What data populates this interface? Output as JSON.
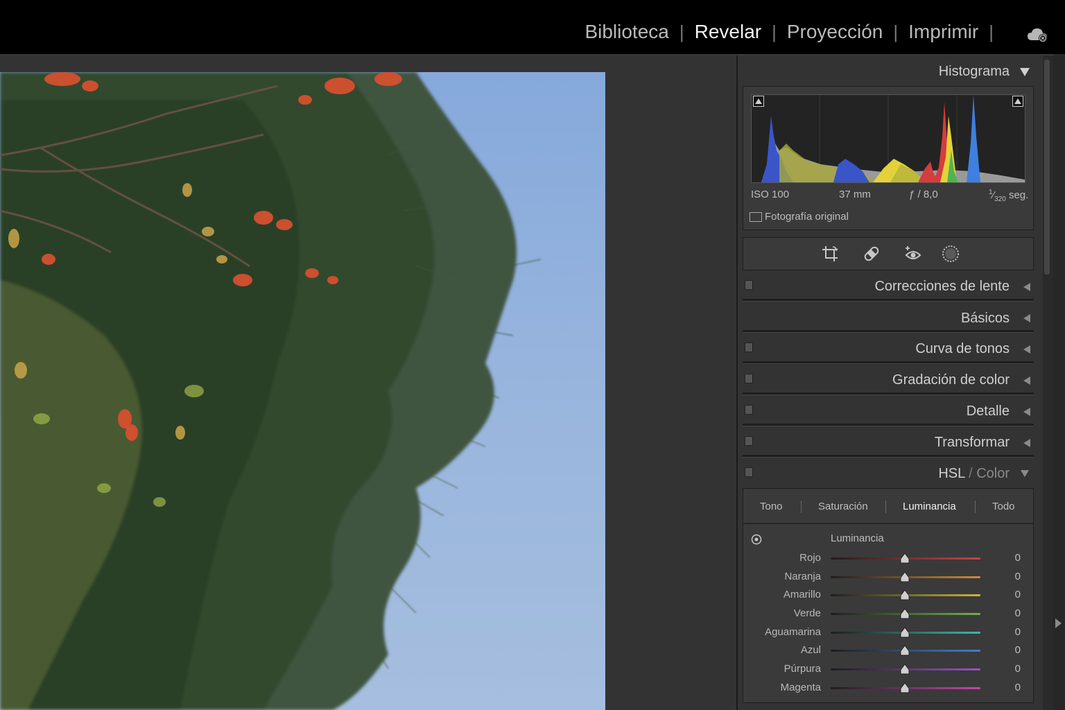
{
  "modules": {
    "items": [
      {
        "label": "Biblioteca",
        "active": false
      },
      {
        "label": "Revelar",
        "active": true
      },
      {
        "label": "Proyección",
        "active": false
      },
      {
        "label": "Imprimir",
        "active": false
      }
    ],
    "cloud_icon": "cloud-sync-icon"
  },
  "histogram": {
    "title": "Histograma",
    "iso": "ISO 100",
    "focal": "37 mm",
    "aperture": "ƒ / 8,0",
    "shutter_num": "1",
    "shutter_den": "320",
    "shutter_unit": "seg.",
    "original_label": "Fotografía original"
  },
  "tools": [
    "crop-icon",
    "healing-icon",
    "redeye-icon",
    "mask-icon"
  ],
  "panels": [
    {
      "title": "Correcciones de lente",
      "has_switch": true
    },
    {
      "title": "Básicos",
      "has_switch": false
    },
    {
      "title": "Curva de tonos",
      "has_switch": true
    },
    {
      "title": "Gradación de color",
      "has_switch": true
    },
    {
      "title": "Detalle",
      "has_switch": true
    },
    {
      "title": "Transformar",
      "has_switch": true
    }
  ],
  "hsl": {
    "title_hsl": "HSL",
    "title_sep": " / ",
    "title_color": "Color",
    "tabs": [
      {
        "label": "Tono",
        "active": false
      },
      {
        "label": "Saturación",
        "active": false
      },
      {
        "label": "Luminancia",
        "active": true
      },
      {
        "label": "Todo",
        "active": false
      }
    ],
    "section_label": "Luminancia",
    "sliders": [
      {
        "label": "Rojo",
        "value": "0",
        "color": "#c9424a"
      },
      {
        "label": "Naranja",
        "value": "0",
        "color": "#d08a3a"
      },
      {
        "label": "Amarillo",
        "value": "0",
        "color": "#cbb73c"
      },
      {
        "label": "Verde",
        "value": "0",
        "color": "#6fb348"
      },
      {
        "label": "Aguamarina",
        "value": "0",
        "color": "#3fb7a8"
      },
      {
        "label": "Azul",
        "value": "0",
        "color": "#3d7fd1"
      },
      {
        "label": "Púrpura",
        "value": "0",
        "color": "#9a52c8"
      },
      {
        "label": "Magenta",
        "value": "0",
        "color": "#c447a8"
      }
    ]
  }
}
